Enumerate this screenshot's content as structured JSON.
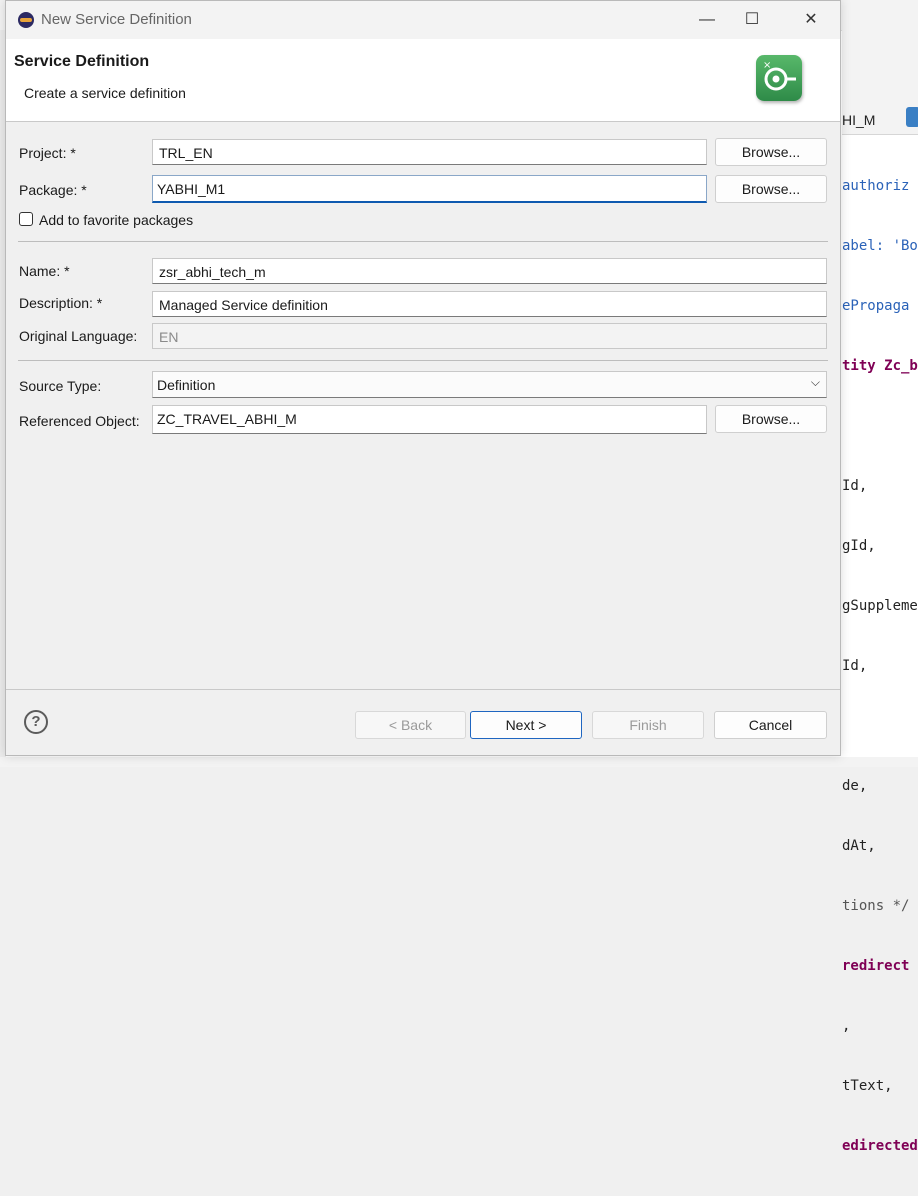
{
  "window": {
    "title": "New Service Definition",
    "minimize_glyph": "—",
    "maximize_glyph": "☐",
    "close_glyph": "✕"
  },
  "banner": {
    "title": "Service Definition",
    "subtitle": "Create a service definition",
    "icon": "service-definition-icon"
  },
  "form": {
    "project_label": "Project: *",
    "project_value": "TRL_EN",
    "package_label": "Package: *",
    "package_value": "YABHI_M1",
    "browse_label": "Browse...",
    "favorite_label": "Add to favorite packages",
    "name_label": "Name: *",
    "name_value": "zsr_abhi_tech_m",
    "description_label": "Description: *",
    "description_value": "Managed Service definition",
    "language_label": "Original Language:",
    "language_value": "EN",
    "source_type_label": "Source Type:",
    "source_type_value": "Definition",
    "ref_label": "Referenced Object:",
    "ref_value": "ZC_TRAVEL_ABHI_M"
  },
  "footer": {
    "help_glyph": "?",
    "back_label": "< Back",
    "next_label": "Next >",
    "finish_label": "Finish",
    "cancel_label": "Cancel"
  },
  "background_editor": {
    "tab_label": "HI_M",
    "code_lines": [
      "authoriz",
      "abel: 'Bo",
      "ePropaga",
      "tity Zc_bo",
      "",
      "Id,",
      "gId,",
      "gSuppleme",
      "Id,",
      "",
      "de,",
      "dAt,",
      "tions */",
      "redirect",
      ",",
      "tText,",
      "edirected"
    ]
  },
  "colors": {
    "accent_blue": "#1f66c1",
    "code_keyword": "#7f0055",
    "code_annotation": "#2a62b8",
    "logo_green": "#3d9b55"
  }
}
